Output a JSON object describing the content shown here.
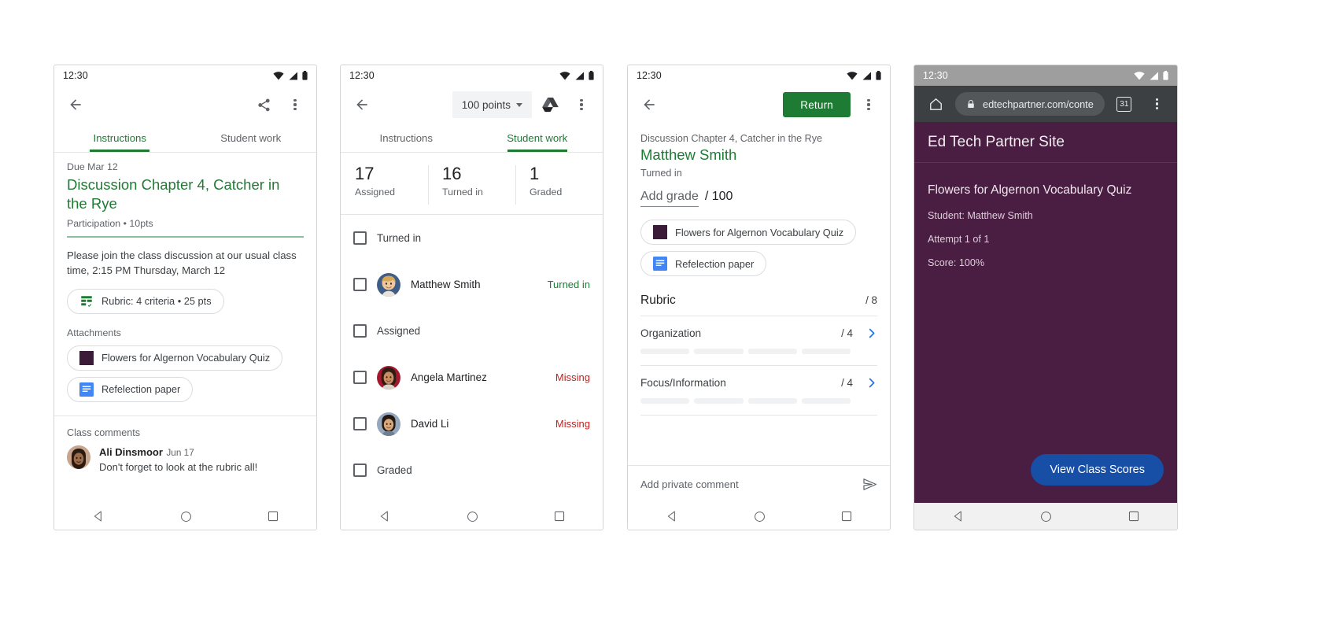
{
  "statusbar": {
    "time": "12:30",
    "icons": [
      "wifi-icon",
      "signal-icon",
      "battery-icon"
    ]
  },
  "panel1": {
    "appbar": {
      "back": "back-arrow-icon",
      "share": "share-icon",
      "overflow": "more-vert-icon"
    },
    "tabs": [
      {
        "label": "Instructions",
        "active": true
      },
      {
        "label": "Student work",
        "active": false
      }
    ],
    "due": "Due Mar 12",
    "title": "Discussion Chapter 4, Catcher in the Rye",
    "meta": "Participation • 10pts",
    "description": "Please join the class discussion at our usual class time, 2:15 PM Thursday, March 12",
    "rubric_chip": "Rubric: 4 criteria • 25 pts",
    "attachments_label": "Attachments",
    "attachments": [
      {
        "label": "Flowers for Algernon Vocabulary Quiz",
        "icon": "quiz-thumbnail-icon",
        "color": "#3c1b38"
      },
      {
        "label": "Refelection paper",
        "icon": "google-docs-icon",
        "color": "#4285f4"
      }
    ],
    "comments_label": "Class comments",
    "comments": [
      {
        "author": "Ali Dinsmoor",
        "date": "Jun 17",
        "text": "Don't forget to look at the rubric all!"
      }
    ]
  },
  "panel2": {
    "appbar": {
      "back": "back-arrow-icon",
      "points": "100 points",
      "drive": "google-drive-icon",
      "overflow": "more-vert-icon"
    },
    "tabs": [
      {
        "label": "Instructions",
        "active": false
      },
      {
        "label": "Student work",
        "active": true
      }
    ],
    "stats": [
      {
        "num": "17",
        "label": "Assigned"
      },
      {
        "num": "16",
        "label": "Turned in"
      },
      {
        "num": "1",
        "label": "Graded"
      }
    ],
    "rows": [
      {
        "type": "group",
        "label": "Turned in"
      },
      {
        "type": "student",
        "name": "Matthew Smith",
        "status": "Turned in",
        "status_kind": "turned",
        "avatar": "matthew-avatar"
      },
      {
        "type": "group",
        "label": "Assigned"
      },
      {
        "type": "student",
        "name": "Angela Martinez",
        "status": "Missing",
        "status_kind": "missing",
        "avatar": "angela-avatar"
      },
      {
        "type": "student",
        "name": "David Li",
        "status": "Missing",
        "status_kind": "missing",
        "avatar": "david-avatar"
      },
      {
        "type": "group",
        "label": "Graded"
      }
    ]
  },
  "panel3": {
    "appbar": {
      "back": "back-arrow-icon",
      "return_label": "Return",
      "overflow": "more-vert-icon"
    },
    "assignment": "Discussion Chapter 4, Catcher in the Rye",
    "student": "Matthew Smith",
    "state": "Turned in",
    "grade_placeholder": "Add grade",
    "grade_total": "/ 100",
    "attachments": [
      {
        "label": "Flowers for Algernon Vocabulary Quiz",
        "icon": "quiz-thumbnail-icon",
        "color": "#3c1b38"
      },
      {
        "label": "Refelection paper",
        "icon": "google-docs-icon",
        "color": "#4285f4"
      }
    ],
    "rubric_title": "Rubric",
    "rubric_total": "/ 8",
    "criteria": [
      {
        "name": "Organization",
        "score": "/ 4",
        "segments": 4,
        "chevron": "chevron-right-icon"
      },
      {
        "name": "Focus/Information",
        "score": "/ 4",
        "segments": 4,
        "chevron": "chevron-right-icon"
      }
    ],
    "comment_placeholder": "Add private comment",
    "send_icon": "send-icon"
  },
  "panel4": {
    "browser": {
      "home": "home-icon",
      "lock": "lock-icon",
      "url": "edtechpartner.com/conte",
      "tab_count": "31",
      "overflow": "more-vert-icon"
    },
    "site_title": "Ed Tech Partner Site",
    "page_title": "Flowers for Algernon Vocabulary Quiz",
    "lines": [
      "Student: Matthew Smith",
      "Attempt 1 of 1",
      "Score: 100%"
    ],
    "cta": "View Class Scores",
    "theme": {
      "bg": "#4a1e42",
      "cta_bg": "#174ea6"
    }
  },
  "navbar": {
    "back": "nav-back-icon",
    "home": "nav-home-icon",
    "recents": "nav-recents-icon"
  }
}
